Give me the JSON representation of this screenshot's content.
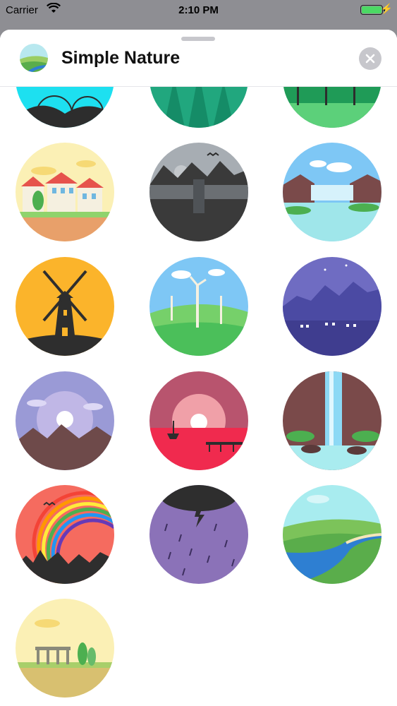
{
  "status_bar": {
    "carrier": "Carrier",
    "time": "2:10 PM"
  },
  "header": {
    "title": "Simple Nature",
    "app_icon": "landscape-icon",
    "close_icon": "close-icon"
  },
  "stickers": [
    {
      "name": "night-hills"
    },
    {
      "name": "pine-forest"
    },
    {
      "name": "green-trees"
    },
    {
      "name": "village-houses"
    },
    {
      "name": "mountain-waterfall-dark"
    },
    {
      "name": "lake-cascade"
    },
    {
      "name": "windmill"
    },
    {
      "name": "wind-turbines"
    },
    {
      "name": "night-town"
    },
    {
      "name": "mountain-sunrise"
    },
    {
      "name": "sunset-sea-boat"
    },
    {
      "name": "canyon-waterfall"
    },
    {
      "name": "rainbow"
    },
    {
      "name": "rain-storm"
    },
    {
      "name": "river-valley"
    },
    {
      "name": "ruins-meadow"
    }
  ]
}
